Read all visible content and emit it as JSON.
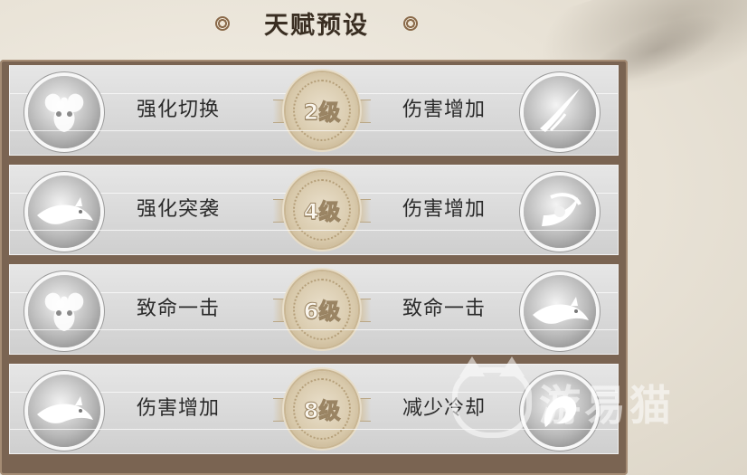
{
  "title": "天赋预设",
  "rows": [
    {
      "left_label": "强化切换",
      "level": "2级",
      "right_label": "伤害增加",
      "left_icon": "ram-horn-icon",
      "right_icon": "slash-strike-icon"
    },
    {
      "left_label": "强化突袭",
      "level": "4级",
      "right_label": "伤害增加",
      "left_icon": "dragon-dash-icon",
      "right_icon": "whirl-strike-icon"
    },
    {
      "left_label": "致命一击",
      "level": "6级",
      "right_label": "致命一击",
      "left_icon": "ram-horn-icon",
      "right_icon": "dragon-dash-icon"
    },
    {
      "left_label": "伤害增加",
      "level": "8级",
      "right_label": "减少冷却",
      "left_icon": "dragon-dash-icon",
      "right_icon": "spirit-beast-icon"
    }
  ],
  "watermark": "游易猫",
  "colors": {
    "frame": "#7a6452",
    "row": "#d9d9d9",
    "medal": "#d8c9ab",
    "title": "#3a2e22"
  }
}
